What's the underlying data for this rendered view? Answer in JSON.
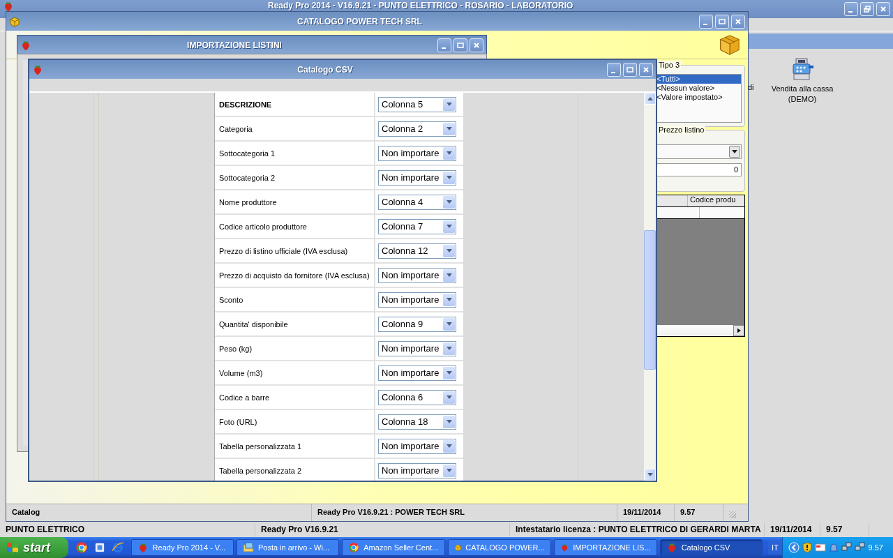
{
  "app_window": {
    "title": "Ready Pro 2014 - V16.9.21 - PUNTO ELETTRICO - ROSARIO - LABORATORIO",
    "side_text": "di",
    "shortcut": "Vendita alla cassa (DEMO)",
    "status_bar": [
      "PUNTO ELETTRICO",
      "Ready Pro V16.9.21",
      "Intestatario licenza : PUNTO ELETTRICO DI GERARDI MARTA",
      "19/11/2014",
      "9.57"
    ]
  },
  "catalog_window": {
    "title": "CATALOGO POWER TECH SRL",
    "tipo_group": {
      "title": "Tipo 3",
      "items": [
        {
          "label": "<Tutti>",
          "selected": true
        },
        {
          "label": "<Nessun valore>",
          "selected": false
        },
        {
          "label": "<Valore impostato>",
          "selected": false
        }
      ]
    },
    "price_group": {
      "title": "Prezzo listino",
      "value": "0"
    },
    "table": {
      "columns": [
        "",
        "Codice produ"
      ]
    },
    "status_bar": [
      "Catalog",
      "Ready Pro V16.9.21 : POWER TECH SRL",
      "19/11/2014",
      "9.57"
    ]
  },
  "import_window": {
    "title": "IMPORTAZIONE LISTINI"
  },
  "csv_window": {
    "title": "Catalogo CSV",
    "fields": [
      {
        "label": "DESCRIZIONE",
        "value": "Colonna 5",
        "required": true
      },
      {
        "label": "Categoria",
        "value": "Colonna 2",
        "required": false
      },
      {
        "label": "Sottocategoria 1",
        "value": "Non importare",
        "required": false
      },
      {
        "label": "Sottocategoria 2",
        "value": "Non importare",
        "required": false
      },
      {
        "label": "Nome produttore",
        "value": "Colonna 4",
        "required": false
      },
      {
        "label": "Codice articolo produttore",
        "value": "Colonna 7",
        "required": false
      },
      {
        "label": "Prezzo di listino ufficiale (IVA esclusa)",
        "value": "Colonna 12",
        "required": false
      },
      {
        "label": "Prezzo di acquisto da fornitore (IVA esclusa)",
        "value": "Non importare",
        "required": false
      },
      {
        "label": "Sconto",
        "value": "Non importare",
        "required": false
      },
      {
        "label": "Quantita' disponibile",
        "value": "Colonna 9",
        "required": false
      },
      {
        "label": "Peso (kg)",
        "value": "Non importare",
        "required": false
      },
      {
        "label": "Volume (m3)",
        "value": "Non importare",
        "required": false
      },
      {
        "label": "Codice a barre",
        "value": "Colonna 6",
        "required": false
      },
      {
        "label": "Foto (URL)",
        "value": "Colonna 18",
        "required": false
      },
      {
        "label": "Tabella personalizzata 1",
        "value": "Non importare",
        "required": false
      },
      {
        "label": "Tabella personalizzata 2",
        "value": "Non importare",
        "required": false
      }
    ]
  },
  "taskbar": {
    "start": "start",
    "tasks": [
      {
        "label": "Ready Pro 2014 - V...",
        "kind": "strawberry",
        "selected": false
      },
      {
        "label": "Posta in arrivo - Wi...",
        "kind": "mail",
        "selected": false
      },
      {
        "label": "Amazon Seller Cent...",
        "kind": "browser",
        "selected": false
      },
      {
        "label": "CATALOGO POWER...",
        "kind": "box",
        "selected": false
      },
      {
        "label": "IMPORTAZIONE LIS...",
        "kind": "strawberry",
        "selected": false
      },
      {
        "label": "Catalogo CSV",
        "kind": "strawberry",
        "selected": true
      }
    ],
    "language": "IT",
    "clock": "9.57"
  }
}
